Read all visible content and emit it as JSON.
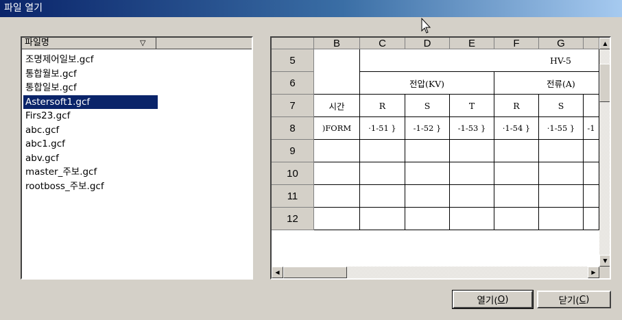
{
  "window": {
    "title": "파일 열기"
  },
  "file_list": {
    "header_label": "파일명",
    "sort_icon": "sort-down-triangle-icon",
    "items": [
      "조명제어일보.gcf",
      "통합월보.gcf",
      "통합일보.gcf",
      "Astersoft1.gcf",
      "Firs23.gcf",
      "abc.gcf",
      "abc1.gcf",
      "abv.gcf",
      "master_주보.gcf",
      "rootboss_주보.gcf"
    ],
    "selected": "Astersoft1.gcf"
  },
  "preview": {
    "columns": [
      "B",
      "C",
      "D",
      "E",
      "F",
      "G"
    ],
    "rows": [
      "5",
      "6",
      "7",
      "8",
      "9",
      "10",
      "11",
      "12"
    ],
    "r5": {
      "merged_label": "HV-5"
    },
    "r6": {
      "voltage": "전압(KV)",
      "current": "전류(A)"
    },
    "r7": [
      "시간",
      "R",
      "S",
      "T",
      "R",
      "S"
    ],
    "r8": [
      ")FORM",
      "·1-51 }",
      "-1-52 }",
      "-1-53 }",
      "·1-54 }",
      "·1-55 }",
      "-1"
    ]
  },
  "buttons": {
    "open": "열기(",
    "open_key": "O",
    "close": "닫기(",
    "close_key": "C",
    "paren": ")"
  }
}
